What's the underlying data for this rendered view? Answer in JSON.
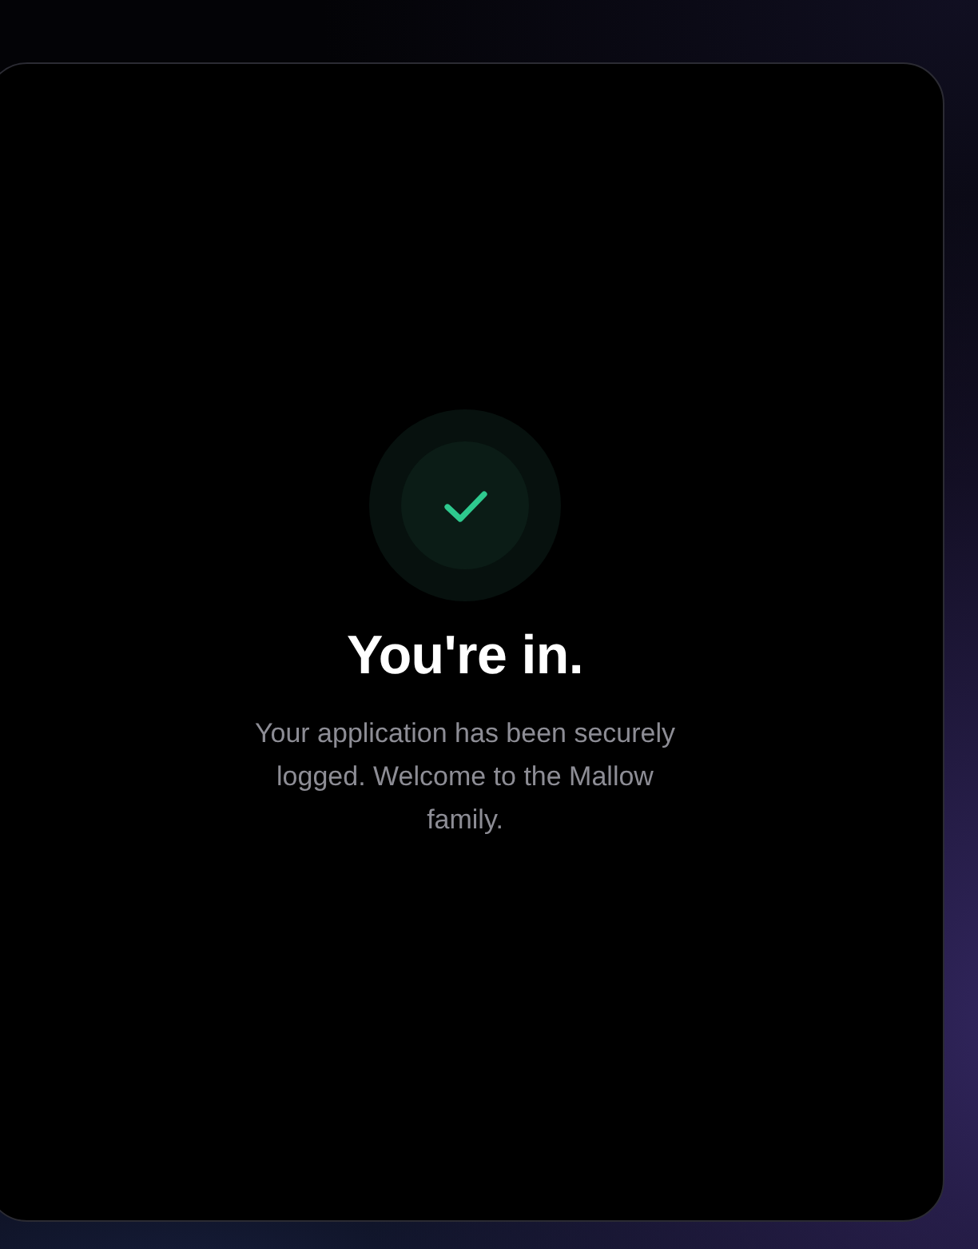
{
  "card": {
    "kind": "success",
    "title": "You're in.",
    "message": "Your application has been securely logged. Welcome to the Mallow family."
  }
}
